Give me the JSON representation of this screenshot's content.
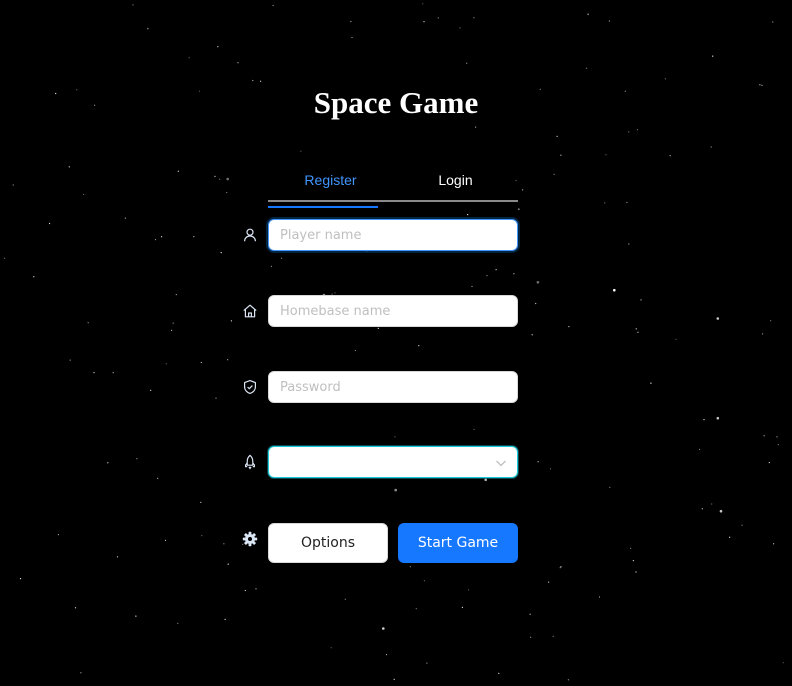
{
  "title": "Space Game",
  "tabs": [
    {
      "label": "Register",
      "active": true
    },
    {
      "label": "Login",
      "active": false
    }
  ],
  "form": {
    "player_name": {
      "placeholder": "Player name",
      "value": ""
    },
    "homebase_name": {
      "placeholder": "Homebase name",
      "value": ""
    },
    "password": {
      "placeholder": "Password",
      "value": ""
    },
    "ship_select": {
      "value": ""
    }
  },
  "buttons": {
    "options_label": "Options",
    "start_label": "Start Game"
  },
  "icons": {
    "player": "user-icon",
    "homebase": "home-icon",
    "password": "shield-icon",
    "ship": "rocket-icon",
    "options": "gear-icon",
    "select": "chevron-down-icon"
  },
  "colors": {
    "background": "#000000",
    "accent": "#1677ff",
    "active_tab": "#4096ff",
    "select_border": "#1cc9d6",
    "icon": "#dbe6f5"
  }
}
